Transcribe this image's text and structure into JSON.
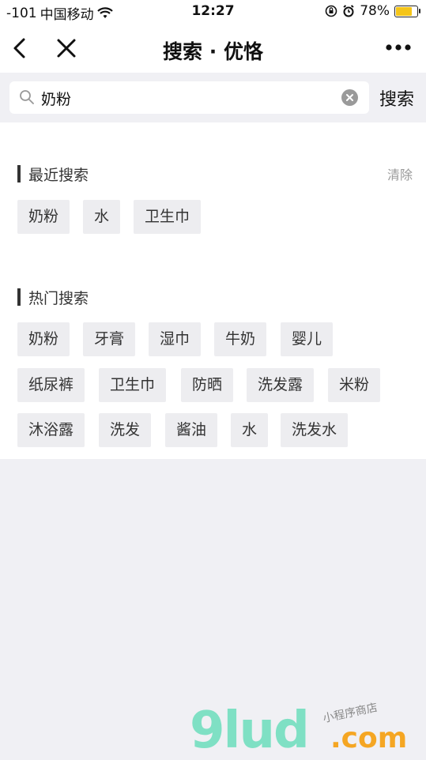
{
  "status_bar": {
    "signal": "-101",
    "carrier": "中国移动",
    "time": "12:27",
    "battery": "78%",
    "battery_level": 0.78
  },
  "nav": {
    "title": "搜索 · 优恪"
  },
  "search": {
    "value": "奶粉",
    "button_label": "搜索"
  },
  "recent": {
    "title": "最近搜索",
    "clear_label": "清除",
    "items": [
      "奶粉",
      "水",
      "卫生巾"
    ]
  },
  "hot": {
    "title": "热门搜索",
    "items": [
      "奶粉",
      "牙膏",
      "湿巾",
      "牛奶",
      "婴儿",
      "纸尿裤",
      "卫生巾",
      "防晒",
      "洗发露",
      "米粉",
      "沐浴露",
      "洗发",
      "酱油",
      "水",
      "洗发水"
    ]
  },
  "watermark": {
    "main": "9lud",
    "suffix": ".com",
    "tagline": "小程序商店"
  },
  "colors": {
    "accent_bar": "#333333",
    "tag_bg": "#ededf0",
    "battery": "#f5c518"
  }
}
